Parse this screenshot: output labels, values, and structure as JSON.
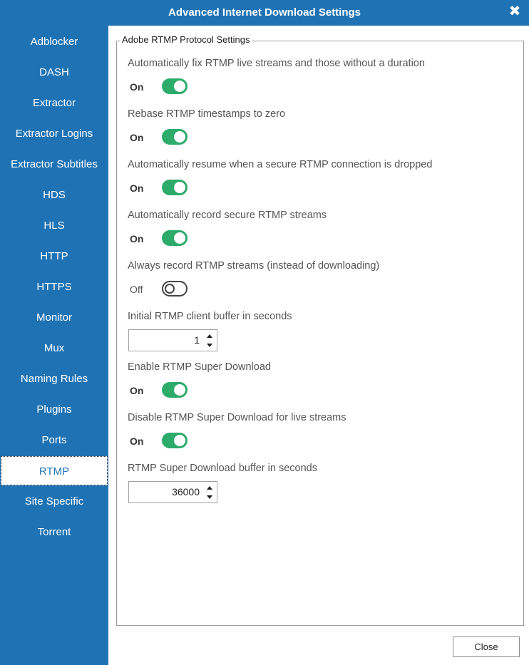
{
  "window": {
    "title": "Advanced Internet Download Settings"
  },
  "sidebar": {
    "items": [
      {
        "label": "Adblocker"
      },
      {
        "label": "DASH"
      },
      {
        "label": "Extractor"
      },
      {
        "label": "Extractor Logins"
      },
      {
        "label": "Extractor Subtitles"
      },
      {
        "label": "HDS"
      },
      {
        "label": "HLS"
      },
      {
        "label": "HTTP"
      },
      {
        "label": "HTTPS"
      },
      {
        "label": "Monitor"
      },
      {
        "label": "Mux"
      },
      {
        "label": "Naming Rules"
      },
      {
        "label": "Plugins"
      },
      {
        "label": "Ports"
      },
      {
        "label": "RTMP",
        "selected": true
      },
      {
        "label": "Site Specific"
      },
      {
        "label": "Torrent"
      }
    ]
  },
  "group": {
    "legend": "Adobe RTMP Protocol Settings"
  },
  "settings": {
    "fix_live": {
      "label": "Automatically fix RTMP live streams and those without a duration",
      "state": "On"
    },
    "rebase": {
      "label": "Rebase RTMP timestamps to zero",
      "state": "On"
    },
    "resume": {
      "label": "Automatically resume when a secure RTMP connection is dropped",
      "state": "On"
    },
    "record_secure": {
      "label": "Automatically record secure RTMP streams",
      "state": "On"
    },
    "always_record": {
      "label": "Always record RTMP streams (instead of downloading)",
      "state": "Off"
    },
    "client_buffer": {
      "label": "Initial RTMP client buffer in seconds",
      "value": "1"
    },
    "super_download": {
      "label": "Enable RTMP Super Download",
      "state": "On"
    },
    "disable_super_live": {
      "label": "Disable RTMP Super Download for live streams",
      "state": "On"
    },
    "super_buffer": {
      "label": "RTMP Super Download buffer in seconds",
      "value": "36000"
    }
  },
  "footer": {
    "close_label": "Close"
  },
  "colors": {
    "accent": "#1f73b4",
    "toggle_on": "#2cab6a"
  }
}
